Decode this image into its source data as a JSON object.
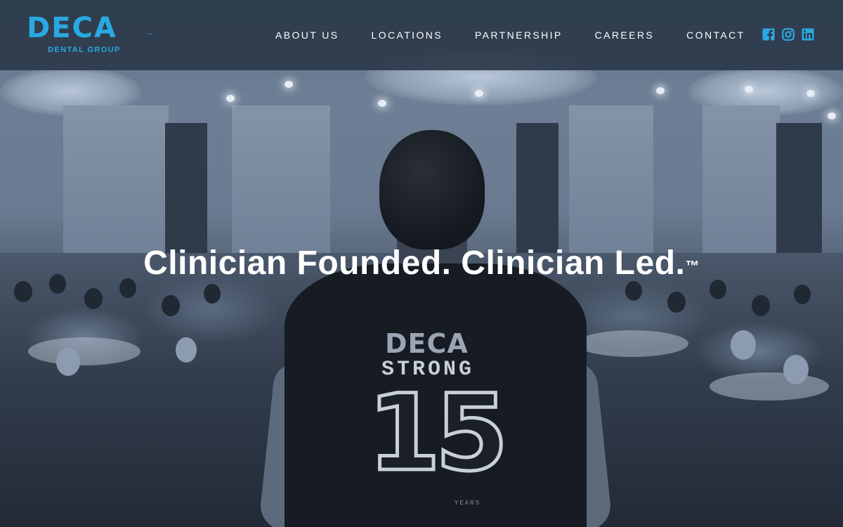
{
  "brand": {
    "logo_main": "DECA",
    "logo_tm": "™",
    "logo_sub": "DENTAL GROUP",
    "accent_color": "#29a9e1"
  },
  "nav": {
    "items": [
      {
        "label": "ABOUT US"
      },
      {
        "label": "LOCATIONS"
      },
      {
        "label": "PARTNERSHIP"
      },
      {
        "label": "CAREERS"
      },
      {
        "label": "CONTACT"
      }
    ]
  },
  "social": {
    "icons": [
      "facebook-icon",
      "instagram-icon",
      "linkedin-icon"
    ]
  },
  "hero": {
    "headline": "Clinician Founded. Clinician Led.",
    "trademark": "™",
    "shirt": {
      "brand": "DECA",
      "word": "STRONG",
      "number": "15",
      "years": "YEARS"
    }
  }
}
